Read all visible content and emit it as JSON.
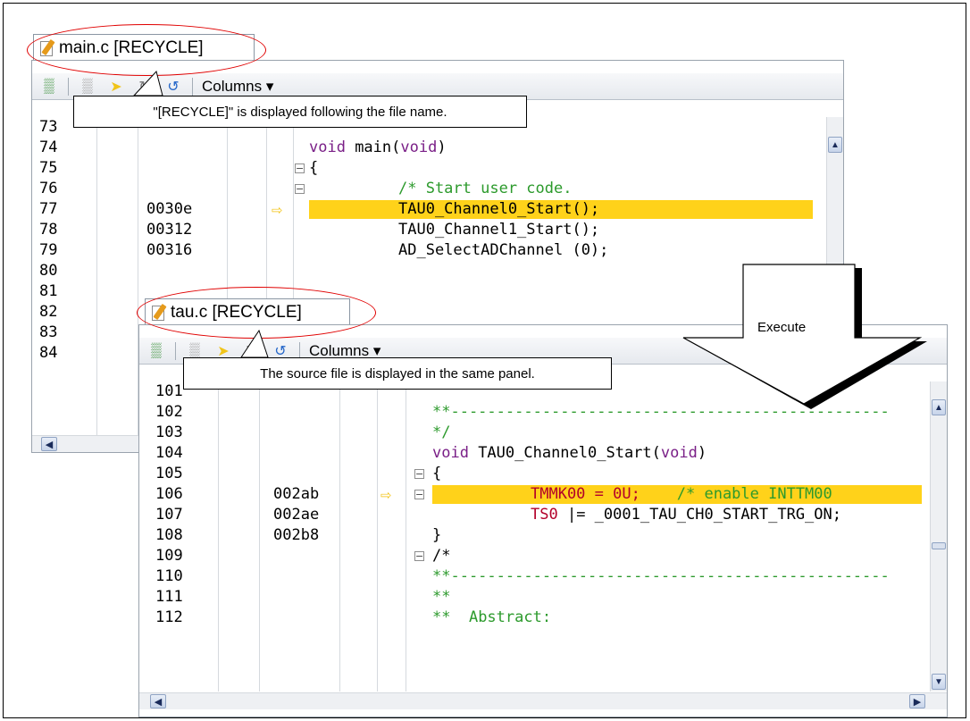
{
  "main_panel": {
    "tab_label": "main.c [RECYCLE]",
    "toolbar_columns": "Columns",
    "rows": [
      {
        "line": "73",
        "addr": "",
        "code": ""
      },
      {
        "line": "74",
        "addr": "",
        "code": "void main(void)"
      },
      {
        "line": "75",
        "addr": "",
        "code": "{"
      },
      {
        "line": "76",
        "addr": "",
        "code": "/* Start user code."
      },
      {
        "line": "77",
        "addr": "0030e",
        "code": "TAU0_Channel0_Start();"
      },
      {
        "line": "78",
        "addr": "00312",
        "code": "TAU0_Channel1_Start();"
      },
      {
        "line": "79",
        "addr": "00316",
        "code": "AD_SelectADChannel (0);"
      },
      {
        "line": "80",
        "addr": "",
        "code": ""
      },
      {
        "line": "81",
        "addr": "",
        "code": ""
      },
      {
        "line": "82",
        "addr": "",
        "code": ""
      },
      {
        "line": "83",
        "addr": "",
        "code": ""
      },
      {
        "line": "84",
        "addr": "",
        "code": ""
      }
    ]
  },
  "tau_panel": {
    "tab_label": "tau.c [RECYCLE]",
    "toolbar_columns": "Columns",
    "rows": [
      {
        "line": "101",
        "addr": "",
        "code": ""
      },
      {
        "line": "102",
        "addr": "",
        "code": "**------------------------------------------------"
      },
      {
        "line": "103",
        "addr": "",
        "code": "*/"
      },
      {
        "line": "104",
        "addr": "",
        "code": "void TAU0_Channel0_Start(void)"
      },
      {
        "line": "105",
        "addr": "",
        "code": "{"
      },
      {
        "line": "106",
        "addr": "002ab",
        "code": "TMMK00 = 0U;"
      },
      {
        "line": "107",
        "addr": "002ae",
        "code": "TS0 |= _0001_TAU_CH0_START_TRG_ON;"
      },
      {
        "line": "108",
        "addr": "002b8",
        "code": "}"
      },
      {
        "line": "109",
        "addr": "",
        "code": "/*"
      },
      {
        "line": "110",
        "addr": "",
        "code": "**------------------------------------------------"
      },
      {
        "line": "111",
        "addr": "",
        "code": "**"
      },
      {
        "line": "112",
        "addr": "",
        "code": "**  Abstract:"
      }
    ],
    "comment_106": "/* enable INTTM00"
  },
  "callouts": {
    "recycle_note": "\"[RECYCLE]\" is displayed following the file name.",
    "panel_note": "The source file is displayed in the same panel."
  },
  "execute_label": "Execute",
  "colors": {
    "highlight": "#ffd21a",
    "ellipse": "#e00000",
    "keyword": "#7a1f87",
    "comment": "#2c9a2c"
  }
}
